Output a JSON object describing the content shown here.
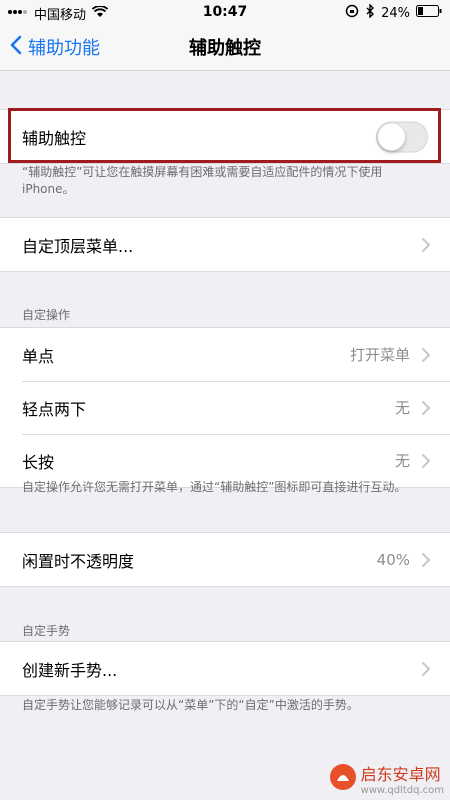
{
  "status_bar": {
    "carrier": "中国移动",
    "time": "10:47",
    "battery": "24%"
  },
  "nav": {
    "back_label": "辅助功能",
    "title": "辅助触控"
  },
  "main_toggle": {
    "label": "辅助触控",
    "enabled": false,
    "description": "“辅助触控”可让您在触摸屏幕有困难或需要自适应配件的情况下使用 iPhone。"
  },
  "customize_menu": {
    "label": "自定顶层菜单..."
  },
  "custom_actions": {
    "header": "自定操作",
    "items": [
      {
        "label": "单点",
        "value": "打开菜单"
      },
      {
        "label": "轻点两下",
        "value": "无"
      },
      {
        "label": "长按",
        "value": "无"
      }
    ],
    "footer": "自定操作允许您无需打开菜单，通过“辅助触控”图标即可直接进行互动。"
  },
  "idle_opacity": {
    "label": "闲置时不透明度",
    "value": "40%"
  },
  "custom_gestures": {
    "header": "自定手势",
    "create_label": "创建新手势...",
    "footer": "自定手势让您能够记录可以从“菜单”下的“自定”中激活的手势。"
  },
  "watermark": {
    "name": "启东安卓网",
    "url": "www.qdltdq.com"
  },
  "colors": {
    "accent": "#1777ee",
    "highlight": "#a01c1c"
  }
}
